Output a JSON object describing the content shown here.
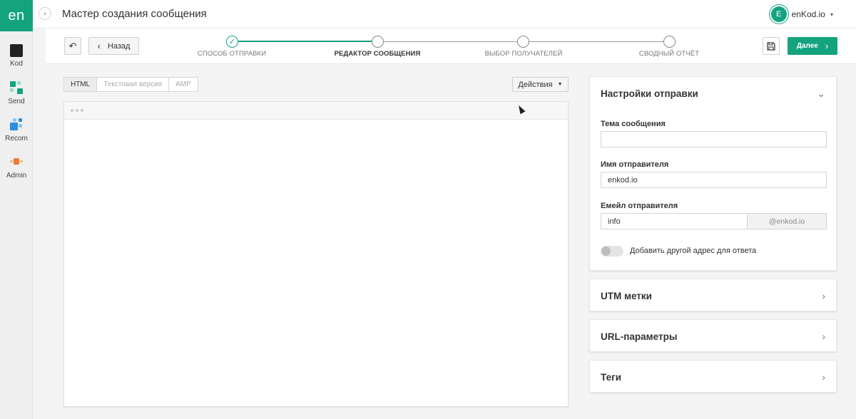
{
  "app": {
    "logo": "en",
    "title": "Мастер создания сообщения"
  },
  "rail": {
    "toggle_icon": "chevron-right-icon",
    "items": [
      {
        "label": "Kod",
        "icon": "kod-icon"
      },
      {
        "label": "Send",
        "icon": "send-icon"
      },
      {
        "label": "Recom",
        "icon": "recom-icon"
      },
      {
        "label": "Admin",
        "icon": "admin-icon"
      }
    ]
  },
  "account": {
    "avatar_letter": "E",
    "name": "enKod.io",
    "caret": "▾"
  },
  "toolbar": {
    "undo_icon": "↶",
    "back_label": "Назад",
    "back_chevron": "‹",
    "save_icon": "💾",
    "next_label": "Далее",
    "next_chevron": "›"
  },
  "steps": [
    {
      "label": "СПОСОБ ОТПРАВКИ",
      "status": "done",
      "mark": "✓"
    },
    {
      "label": "РЕДАКТОР СООБЩЕНИЯ",
      "status": "active"
    },
    {
      "label": "ВЫБОР ПОЛУЧАТЕЛЕЙ",
      "status": "pending"
    },
    {
      "label": "СВОДНЫЙ ОТЧЁТ",
      "status": "pending"
    }
  ],
  "editor": {
    "tabs": [
      {
        "label": "HTML",
        "active": true
      },
      {
        "label": "Текстовая версия",
        "active": false
      },
      {
        "label": "AMP",
        "active": false
      }
    ],
    "actions_label": "Действия",
    "actions_caret": "▼"
  },
  "settings": {
    "title": "Настройки отправки",
    "chevron": "⌄",
    "subject": {
      "label": "Тема сообщения",
      "value": ""
    },
    "sender_name": {
      "label": "Имя отправителя",
      "value": "enkod.io"
    },
    "sender_email": {
      "label": "Емейл отправителя",
      "value": "info",
      "domain": "@enkod.io"
    },
    "reply_toggle": {
      "label": "Добавить другой адрес для ответа",
      "on": false
    }
  },
  "panels": [
    {
      "title": "UTM метки",
      "chevron": "›"
    },
    {
      "title": "URL-параметры",
      "chevron": "›"
    },
    {
      "title": "Теги",
      "chevron": "›"
    }
  ],
  "colors": {
    "accent": "#14a37f",
    "text": "#333333",
    "background": "#f4f4f4"
  }
}
